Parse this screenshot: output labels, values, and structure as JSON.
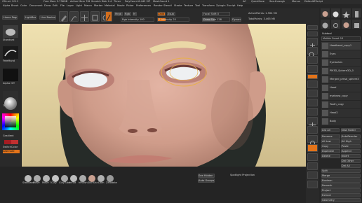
{
  "app": {
    "title": "ZBrush 2019",
    "status_items": [
      "Free Mem 3.736GB",
      "Active Mem 768",
      "Scratch Disk 2.4",
      "Timer",
      "PolyCount 6.442 MP",
      "MeshCount 1"
    ],
    "right_title_items": [
      "AC",
      "QuickSave",
      "See-through",
      "Menus",
      "DefaultZScript"
    ]
  },
  "menubar": [
    "Alpha",
    "Brush",
    "Color",
    "Document",
    "Draw",
    "Edit",
    "File",
    "Layer",
    "Light",
    "Macro",
    "Marker",
    "Material",
    "Movie",
    "Picker",
    "Preferences",
    "Render",
    "Stencil",
    "Stroke",
    "Texture",
    "Tool",
    "Transform",
    "Zplugin",
    "Zscript",
    "Help"
  ],
  "toolbar": {
    "home_page": "Home Page",
    "lightbox": "LightBox",
    "live_boolean": "Live Boolean",
    "mrgb": "Mrgb",
    "rgb": "Rgb",
    "m": "M",
    "zadd": "Zadd",
    "zsub": "Zsub",
    "rgb_intensity": "Rgb Intensity 100",
    "z_intensity": "Z Intensity 25",
    "focal_shift": "Focal Shift 0",
    "draw_size": "Draw Size 128",
    "active_points": "ActivePoints: 1.904 Mil",
    "total_points": "TotalPoints: 3.465 Mil",
    "dynamic": "Dynamic"
  },
  "left_shelf": {
    "brush_label": "Standard",
    "stroke_label": "FreeHand",
    "alpha_label": "Alpha Off",
    "texture_label": "Texture Off",
    "material_label": "MatCap",
    "gradient_label": "Gradient",
    "switch_color": "SwitchColor",
    "alternate": "Alternate",
    "primary_color": "#c03030",
    "secondary_color": "#a51c22"
  },
  "subtool": {
    "title": "Subtool",
    "visible_count": "Visible Count 10",
    "items": [
      "Headband_copy1",
      "Eyes",
      "Eyelashes",
      "PM3D_Sphere3D_0",
      "Merged_pmsd_sphere3D",
      "Head",
      "eyebrow_copy",
      "Tooth_copy",
      "Head2",
      "Body"
    ],
    "list_all": "List All",
    "new_folder": "New Folder",
    "buttons": [
      "Rename",
      "AutoReorder",
      "All Low",
      "All High",
      "Copy",
      "Paste",
      "Duplicate",
      "Append",
      "Insert",
      "Delete",
      "Del Other",
      "Del All",
      "Split",
      "Merge",
      "Boolean",
      "Remesh",
      "Project",
      "Extract"
    ],
    "bottom": [
      "Geometry",
      "ArrayMesh"
    ]
  },
  "bottom_shelf": {
    "brushes": [
      "Standard",
      "Move",
      "Move Tc",
      "Clay",
      "ClayTubes",
      "Inflat",
      "hPolish",
      "SkinShade",
      "Dam",
      "ZModeler"
    ],
    "spotlight": "Spotlight Projection",
    "see_hidden": "See Hidden",
    "auto_groups": "Auto Groups"
  },
  "right_tray": [
    "Bpr",
    "SPix 3",
    "Scroll",
    "Zoom",
    "Actual",
    "AAHalf",
    "Dynamic Persp",
    "Floor",
    "Local",
    "Gizmo",
    "Frame",
    "Move",
    "Scale",
    "Rotate",
    "Line Fill PolyF",
    "Transp",
    "Ghost",
    "Solo",
    "Xpose"
  ],
  "colors": {
    "accent": "#e2731a",
    "ui_bg": "#2a2a2a",
    "canvas_bg": "#262b28"
  }
}
